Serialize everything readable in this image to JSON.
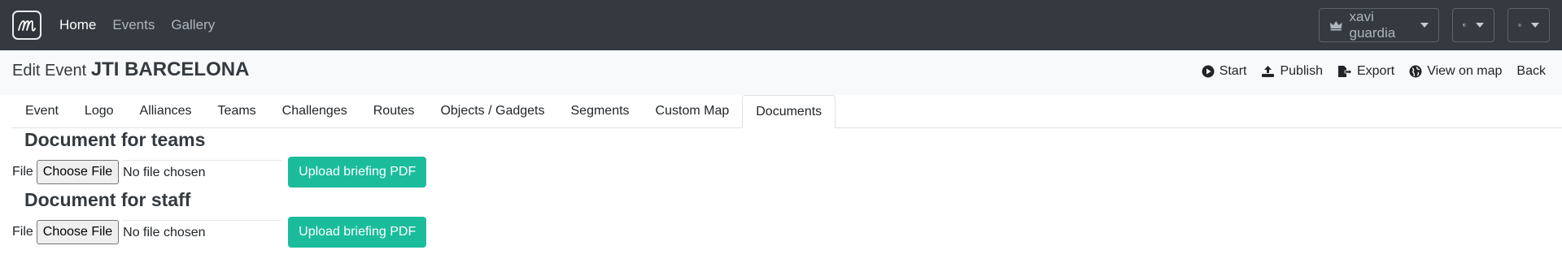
{
  "nav": {
    "links": [
      {
        "label": "Home",
        "active": true
      },
      {
        "label": "Events",
        "active": false
      },
      {
        "label": "Gallery",
        "active": false
      }
    ],
    "user": "xavi guardia",
    "icons": [
      "crown-icon",
      "shield-icon",
      "globe-icon"
    ]
  },
  "header": {
    "edit_label": "Edit Event",
    "event_name": "JTI BARCELONA",
    "actions": {
      "start": "Start",
      "publish": "Publish",
      "export": "Export",
      "view_on_map": "View on map",
      "back": "Back"
    }
  },
  "tabs": [
    {
      "label": "Event"
    },
    {
      "label": "Logo"
    },
    {
      "label": "Alliances"
    },
    {
      "label": "Teams"
    },
    {
      "label": "Challenges"
    },
    {
      "label": "Routes"
    },
    {
      "label": "Objects / Gadgets"
    },
    {
      "label": "Segments"
    },
    {
      "label": "Custom Map"
    },
    {
      "label": "Documents",
      "active": true
    }
  ],
  "documents": {
    "teams": {
      "title": "Document for teams",
      "file_label": "File",
      "choose_label": "Choose File",
      "status": "No file chosen",
      "upload_label": "Upload briefing PDF"
    },
    "staff": {
      "title": "Document for staff",
      "file_label": "File",
      "choose_label": "Choose File",
      "status": "No file chosen",
      "upload_label": "Upload briefing PDF"
    }
  },
  "colors": {
    "navbar": "#343a40",
    "subheader": "#f8f9fa",
    "accent": "#1abc9c"
  }
}
